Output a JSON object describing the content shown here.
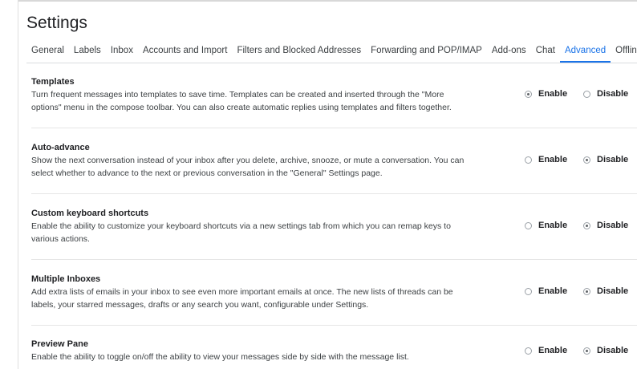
{
  "page": {
    "title": "Settings"
  },
  "tabs": [
    {
      "label": "General"
    },
    {
      "label": "Labels"
    },
    {
      "label": "Inbox"
    },
    {
      "label": "Accounts and Import"
    },
    {
      "label": "Filters and Blocked Addresses"
    },
    {
      "label": "Forwarding and POP/IMAP"
    },
    {
      "label": "Add-ons"
    },
    {
      "label": "Chat"
    },
    {
      "label": "Advanced",
      "active": true
    },
    {
      "label": "Offline"
    }
  ],
  "sections": [
    {
      "title": "Templates",
      "description": "Turn frequent messages into templates to save time. Templates can be created and inserted through the \"More options\" menu in the compose toolbar. You can also create automatic replies using templates and filters together.",
      "enable_label": "Enable",
      "disable_label": "Disable",
      "selected": "Enable"
    },
    {
      "title": "Auto-advance",
      "description": "Show the next conversation instead of your inbox after you delete, archive, snooze, or mute a conversation. You can select whether to advance to the next or previous conversation in the \"General\" Settings page.",
      "enable_label": "Enable",
      "disable_label": "Disable",
      "selected": "Disable"
    },
    {
      "title": "Custom keyboard shortcuts",
      "description": "Enable the ability to customize your keyboard shortcuts via a new settings tab from which you can remap keys to various actions.",
      "enable_label": "Enable",
      "disable_label": "Disable",
      "selected": "Disable"
    },
    {
      "title": "Multiple Inboxes",
      "description": "Add extra lists of emails in your inbox to see even more important emails at once. The new lists of threads can be labels, your starred messages, drafts or any search you want, configurable under Settings.",
      "enable_label": "Enable",
      "disable_label": "Disable",
      "selected": "Disable"
    },
    {
      "title": "Preview Pane",
      "description": "Enable the ability to toggle on/off the ability to view your messages side by side with the message list.",
      "enable_label": "Enable",
      "disable_label": "Disable",
      "selected": "Disable"
    }
  ],
  "colors": {
    "accent": "#1a73e8",
    "text": "#202124",
    "divider": "#e6e6e6"
  }
}
